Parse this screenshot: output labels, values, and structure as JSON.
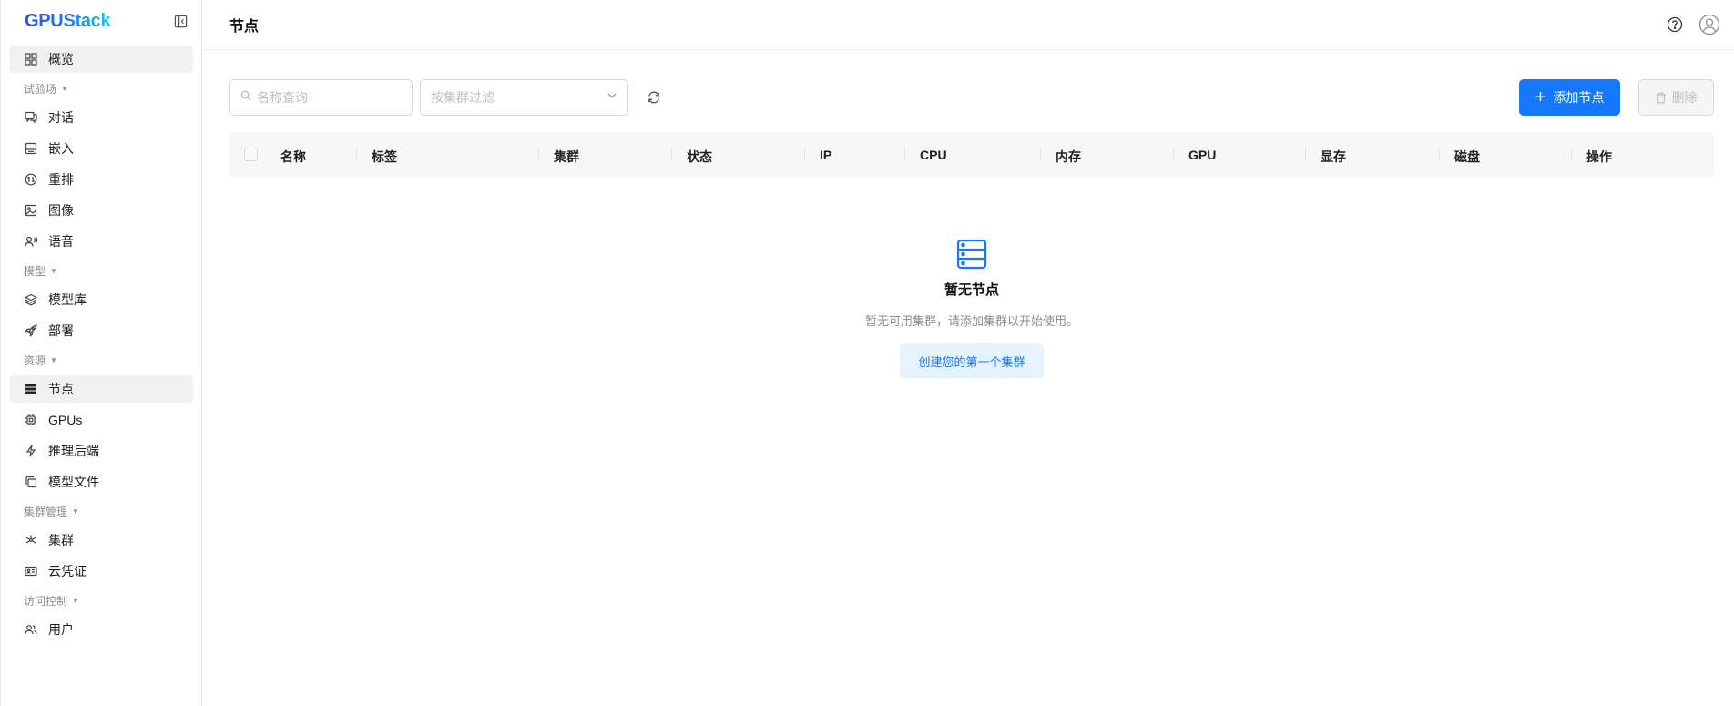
{
  "brand": {
    "name": "GPUStack"
  },
  "sidebar": {
    "overview": {
      "label": "概览",
      "icon": "grid-icon"
    },
    "groups": [
      {
        "label": "试验场",
        "items": [
          {
            "label": "对话",
            "icon": "chat-icon"
          },
          {
            "label": "嵌入",
            "icon": "embed-icon"
          },
          {
            "label": "重排",
            "icon": "rerank-icon"
          },
          {
            "label": "图像",
            "icon": "image-icon"
          },
          {
            "label": "语音",
            "icon": "voice-icon"
          }
        ]
      },
      {
        "label": "模型",
        "items": [
          {
            "label": "模型库",
            "icon": "layers-icon"
          },
          {
            "label": "部署",
            "icon": "rocket-icon"
          }
        ]
      },
      {
        "label": "资源",
        "items": [
          {
            "label": "节点",
            "icon": "server-icon",
            "active": true
          },
          {
            "label": "GPUs",
            "icon": "chip-icon"
          },
          {
            "label": "推理后端",
            "icon": "bolt-icon"
          },
          {
            "label": "模型文件",
            "icon": "files-icon"
          }
        ]
      },
      {
        "label": "集群管理",
        "items": [
          {
            "label": "集群",
            "icon": "cluster-icon"
          },
          {
            "label": "云凭证",
            "icon": "credential-icon"
          }
        ]
      },
      {
        "label": "访问控制",
        "items": [
          {
            "label": "用户",
            "icon": "users-icon"
          }
        ]
      }
    ]
  },
  "header": {
    "title": "节点"
  },
  "toolbar": {
    "search_placeholder": "名称查询",
    "cluster_filter_placeholder": "按集群过滤",
    "add_label": "添加节点",
    "delete_label": "删除"
  },
  "table": {
    "columns": [
      "名称",
      "标签",
      "集群",
      "状态",
      "IP",
      "CPU",
      "内存",
      "GPU",
      "显存",
      "磁盘",
      "操作"
    ],
    "rows": []
  },
  "empty_state": {
    "title": "暂无节点",
    "description": "暂无可用集群，请添加集群以开始使用。",
    "button_label": "创建您的第一个集群"
  },
  "colors": {
    "primary": "#1677ff",
    "primary_light": "#e6f4ff",
    "active_bg": "#f1f1f1"
  }
}
